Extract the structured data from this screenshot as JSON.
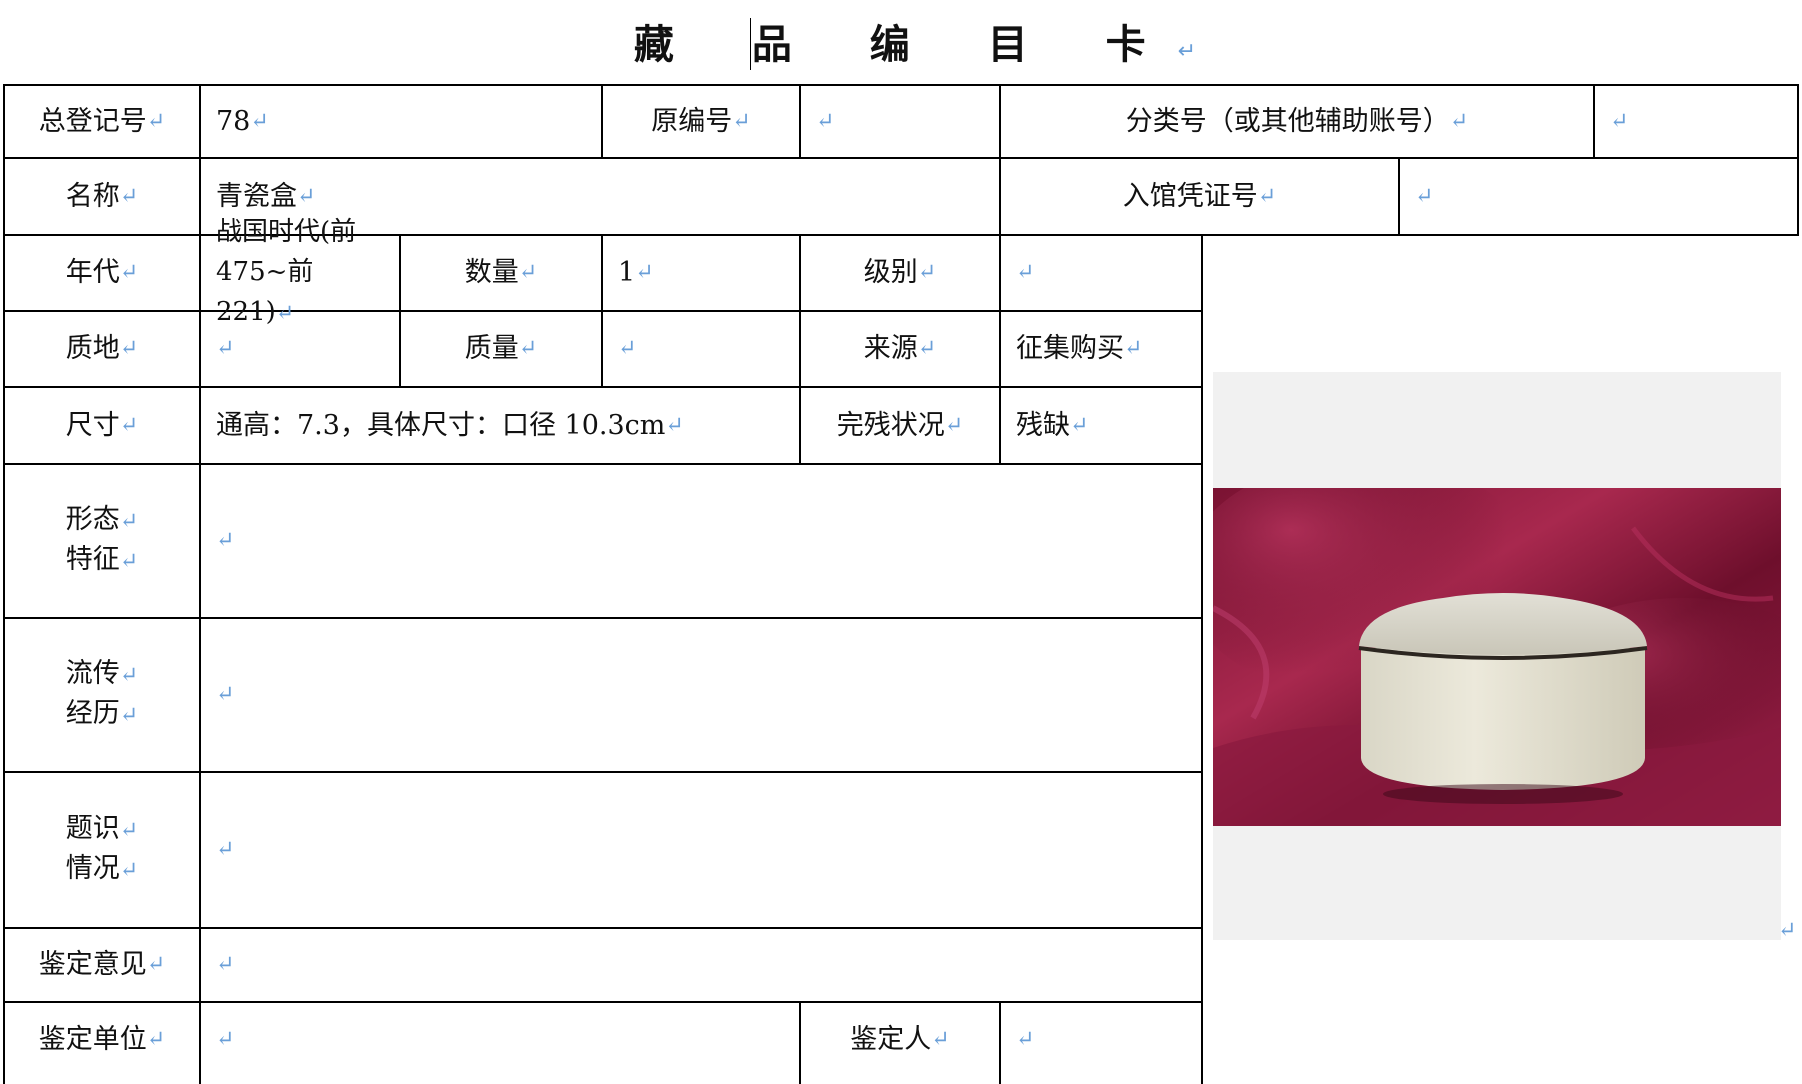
{
  "title": "藏 品 编 目 卡",
  "return_mark": "↵",
  "rows": {
    "r1": {
      "total_reg_label": "总登记号",
      "total_reg_value": "78",
      "orig_no_label": "原编号",
      "orig_no_value": "",
      "class_no_label": "分类号（或其他辅助账号）",
      "class_no_value": ""
    },
    "r2": {
      "name_label": "名称",
      "name_value": "青瓷盒",
      "voucher_label": "入馆凭证号",
      "voucher_value": ""
    },
    "r3": {
      "era_label": "年代",
      "era_value_line1": "战国时代(前",
      "era_value_line2": "475~前 221)",
      "qty_label": "数量",
      "qty_value": "1",
      "grade_label": "级别",
      "grade_value": ""
    },
    "r4": {
      "material_label": "质地",
      "material_value": "",
      "mass_label": "质量",
      "mass_value": "",
      "source_label": "来源",
      "source_value": "征集购买"
    },
    "r5": {
      "size_label": "尺寸",
      "size_value": "通高：7.3，具体尺寸：口径 10.3cm",
      "condition_label": "完残状况",
      "condition_value": "残缺"
    },
    "r6": {
      "label_line1": "形态",
      "label_line2": "特征",
      "value": ""
    },
    "r7": {
      "label_line1": "流传",
      "label_line2": "经历",
      "value": ""
    },
    "r8": {
      "label_line1": "题识",
      "label_line2": "情况",
      "value": ""
    },
    "r9": {
      "label": "鉴定意见",
      "value": ""
    },
    "r10": {
      "unit_label": "鉴定单位",
      "unit_value": "",
      "appraiser_label": "鉴定人",
      "appraiser_value": ""
    }
  },
  "photo": {
    "icon": "celadon-box-photo"
  },
  "colors": {
    "border": "#000000",
    "mark": "#6a9fd8",
    "cloth": "#8c1838",
    "photo_bg": "#f1f1f1"
  }
}
